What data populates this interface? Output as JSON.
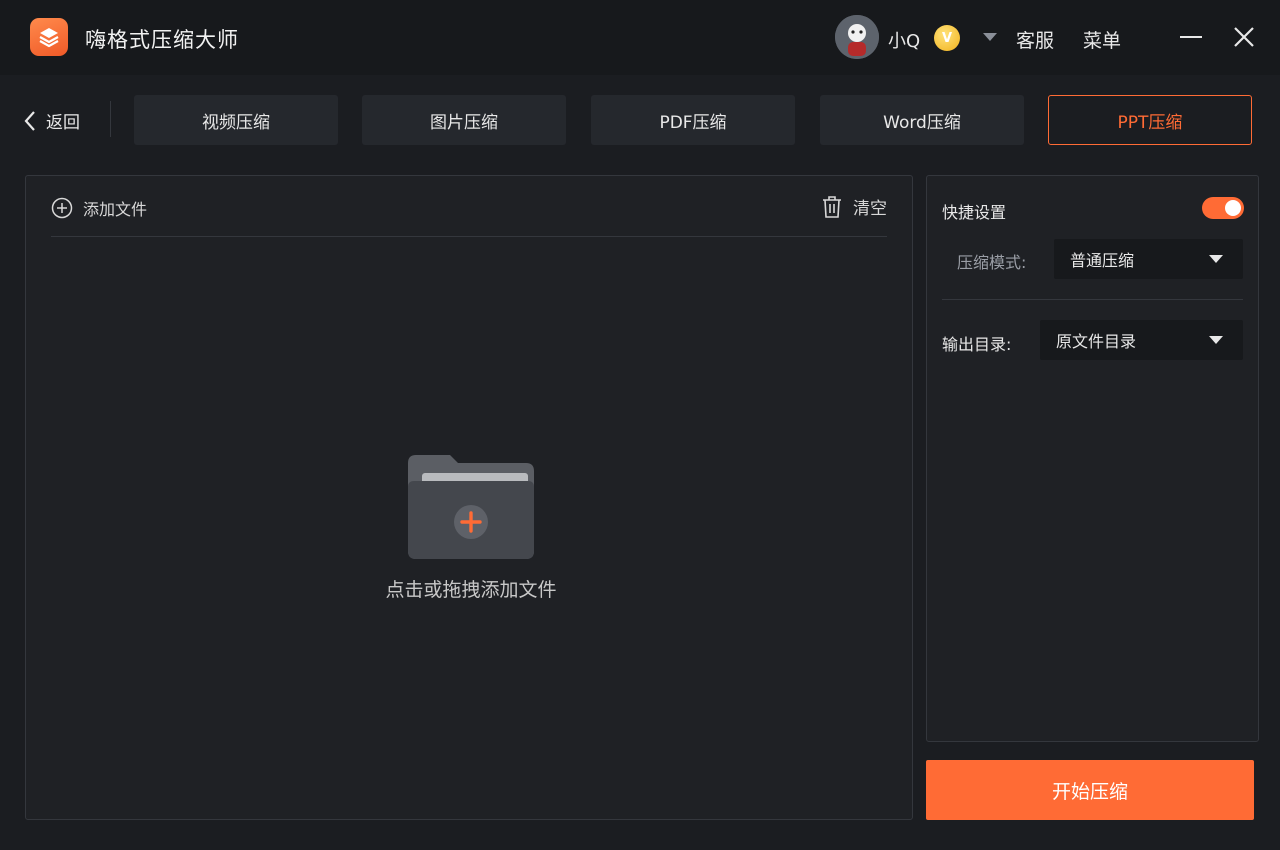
{
  "app": {
    "title": "嗨格式压缩大师"
  },
  "header": {
    "username": "小Q",
    "vip_badge": "V",
    "service_label": "客服",
    "menu_label": "菜单"
  },
  "nav": {
    "back_label": "返回",
    "tabs": [
      {
        "label": "视频压缩",
        "active": false
      },
      {
        "label": "图片压缩",
        "active": false
      },
      {
        "label": "PDF压缩",
        "active": false
      },
      {
        "label": "Word压缩",
        "active": false
      },
      {
        "label": "PPT压缩",
        "active": true
      }
    ]
  },
  "file_panel": {
    "add_file_label": "添加文件",
    "clear_label": "清空",
    "drop_hint": "点击或拖拽添加文件"
  },
  "settings": {
    "quick_settings_label": "快捷设置",
    "quick_settings_enabled": true,
    "mode_label": "压缩模式:",
    "mode_value": "普通压缩",
    "output_label": "输出目录:",
    "output_value": "原文件目录"
  },
  "actions": {
    "start_label": "开始压缩"
  },
  "colors": {
    "accent": "#ff6b35",
    "background": "#1b1d21",
    "panel": "#1f2125"
  }
}
